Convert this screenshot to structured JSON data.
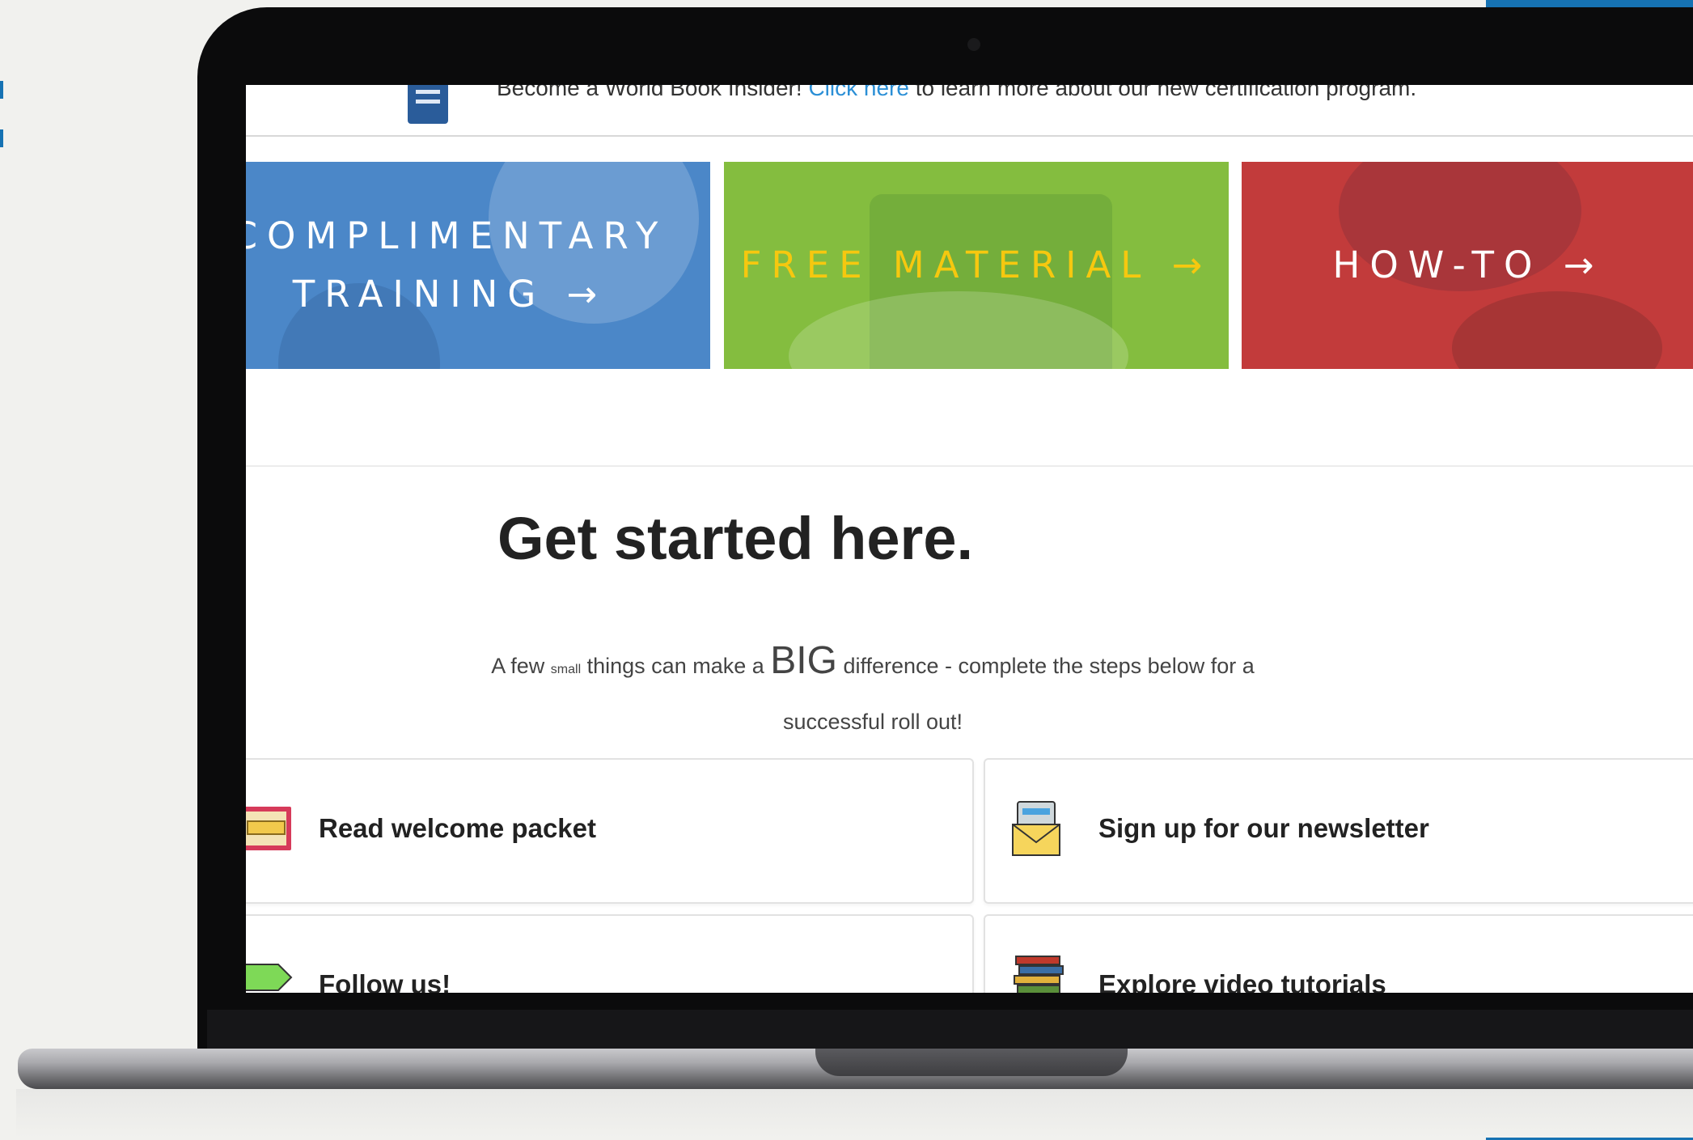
{
  "banner": {
    "text_before": "Become a World Book Insider! ",
    "link": "Click here",
    "text_after": " to learn more about our new certification program.",
    "icon": "document-icon"
  },
  "tiles": [
    {
      "label": "COMPLIMENTARY TRAINING →",
      "line1": "COMPLIMENTARY",
      "line2": "TRAINING →",
      "color": "#4b87c8",
      "text_color": "#ffffff"
    },
    {
      "label": "FREE MATERIAL →",
      "color": "#84bd3f",
      "text_color": "#f6c80f"
    },
    {
      "label": "HOW-TO →",
      "color": "#c23b3b",
      "text_color": "#ffffff"
    }
  ],
  "headline": "Get started here.",
  "subheadline": {
    "part1": "A few ",
    "small": "small",
    "part2": " things can make a ",
    "big": "BIG",
    "part3": " difference - complete the steps below for a successful roll out!"
  },
  "cards": [
    {
      "label": "Read welcome packet",
      "icon": "welcome-stamp-icon"
    },
    {
      "label": "Sign up for our newsletter",
      "icon": "envelope-icon"
    },
    {
      "label": "Follow us!",
      "icon": "follow-tag-icon"
    },
    {
      "label": "Explore video tutorials",
      "icon": "book-stack-icon"
    }
  ],
  "colors": {
    "accent_blue": "#1672b3",
    "link": "#2b8fd6"
  }
}
